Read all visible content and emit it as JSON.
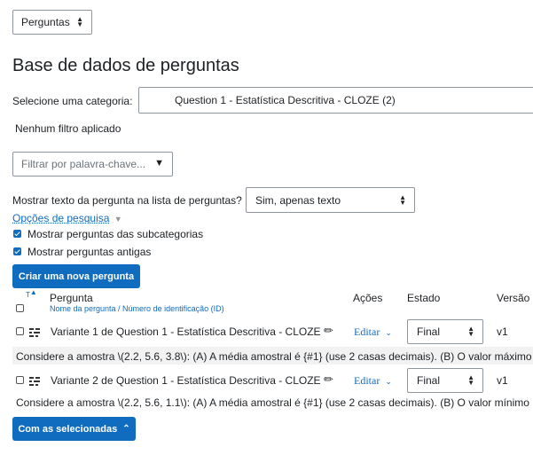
{
  "nav_select": {
    "value": "Perguntas"
  },
  "page_title": "Base de dados de perguntas",
  "category": {
    "label": "Selecione uma categoria:",
    "value": "Question 1 - Estatística Descritiva - CLOZE (2)"
  },
  "filter_status": "Nenhum filtro aplicado",
  "keyword_filter": {
    "placeholder": "Filtrar por palavra-chave..."
  },
  "show_text": {
    "label": "Mostrar texto da pergunta na lista de perguntas?",
    "value": "Sim, apenas texto"
  },
  "search_options": {
    "label": "Opções de pesquisa"
  },
  "checkboxes": [
    {
      "label": "Mostrar perguntas das subcategorias",
      "checked": true
    },
    {
      "label": "Mostrar perguntas antigas",
      "checked": true
    }
  ],
  "create_button": "Criar uma nova pergunta",
  "table": {
    "sort_t": "T",
    "header_question": "Pergunta",
    "header_sub": "Nome da pergunta / Número de identificação (ID)",
    "header_actions": "Ações",
    "header_status": "Estado",
    "header_version": "Versão",
    "rows": [
      {
        "name": "Variante 1 de Question 1 - Estatística Descritiva - CLOZE",
        "action": "Editar",
        "status": "Final",
        "version": "v1",
        "text": "Considere a amostra \\(2.2, 5.6, 3.8\\): (A) A média amostral é {#1} (use 2 casas decimais). (B) O valor máximo"
      },
      {
        "name": "Variante 2 de Question 1 - Estatística Descritiva - CLOZE",
        "action": "Editar",
        "status": "Final",
        "version": "v1",
        "text": "Considere a amostra \\(2.2, 5.6, 1.1\\): (A) A média amostral é {#1} (use 2 casas decimais). (B) O valor mínimo"
      }
    ]
  },
  "bulk_button": "Com as selecionadas",
  "colors": {
    "primary": "#0f6cbf",
    "row_bg": "#f2f2f2"
  }
}
